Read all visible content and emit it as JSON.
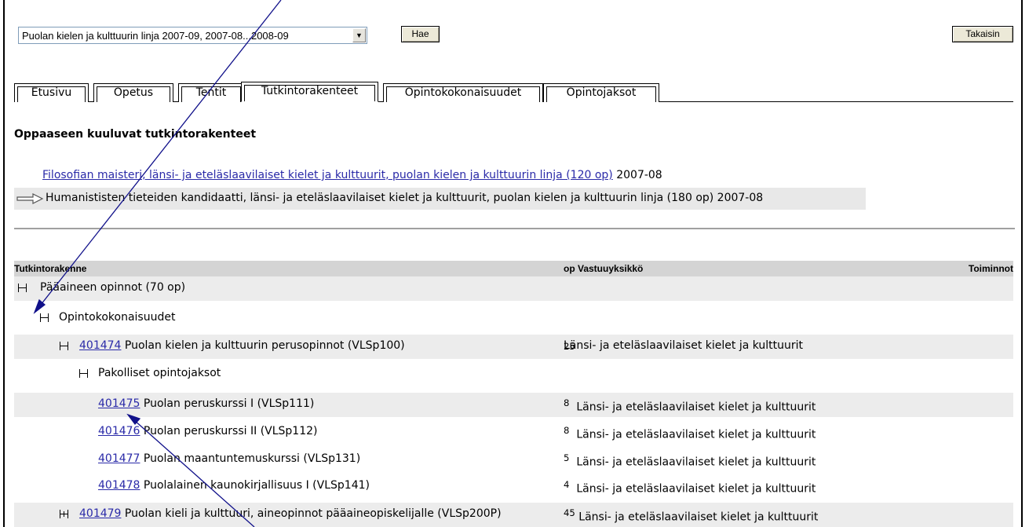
{
  "program_select": {
    "value": "Puolan kielen ja kulttuurin linja 2007-09, 2007-08...2008-09"
  },
  "buttons": {
    "hae": "Hae",
    "back": "Takaisin"
  },
  "tabs": [
    {
      "label": "Etusivu"
    },
    {
      "label": "Opetus"
    },
    {
      "label": "Tentit"
    },
    {
      "label": "Tutkintorakenteet"
    },
    {
      "label": "Opintokokonaisuudet"
    },
    {
      "label": "Opintojaksot"
    }
  ],
  "heading": "Oppaaseen kuuluvat tutkintorakenteet",
  "degrees": [
    {
      "link": "Filosofian maisteri, länsi- ja eteläslaavilaiset kielet ja kulttuurit, puolan kielen ja kulttuurin linja (120 op)",
      "year": "2007-08"
    },
    {
      "text": "Humanististen tieteiden kandidaatti, länsi- ja eteläslaavilaiset kielet ja kulttuurit, puolan kielen ja kulttuurin linja (180 op) 2007-08"
    }
  ],
  "table": {
    "headers": {
      "structure": "Tutkintorakenne",
      "op_unit": "op Vastuuyksikkö",
      "actions": "Toiminnot"
    },
    "rows": [
      {
        "code": "",
        "text": "Pääaineen opinnot (70 op)",
        "op": "",
        "unit": ""
      },
      {
        "code": "",
        "text": "Opintokokonaisuudet",
        "op": "",
        "unit": ""
      },
      {
        "code": "401474",
        "text": " Puolan kielen ja kulttuurin perusopinnot (VLSp100)",
        "op": "25",
        "unit": "Länsi- ja eteläslaavilaiset kielet ja kulttuurit"
      },
      {
        "code": "",
        "text": "Pakolliset opintojaksot",
        "op": "",
        "unit": ""
      },
      {
        "code": "401475",
        "text": " Puolan peruskurssi I (VLSp111)",
        "op": "8",
        "unit": "Länsi- ja eteläslaavilaiset kielet ja kulttuurit"
      },
      {
        "code": "401476",
        "text": " Puolan peruskurssi II (VLSp112)",
        "op": "8",
        "unit": "Länsi- ja eteläslaavilaiset kielet ja kulttuurit"
      },
      {
        "code": "401477",
        "text": " Puolan maantuntemuskurssi (VLSp131)",
        "op": "5",
        "unit": "Länsi- ja eteläslaavilaiset kielet ja kulttuurit"
      },
      {
        "code": "401478",
        "text": " Puolalainen kaunokirjallisuus I (VLSp141)",
        "op": "4",
        "unit": "Länsi- ja eteläslaavilaiset kielet ja kulttuurit"
      },
      {
        "code": "401479",
        "text": " Puolan kieli ja kulttuuri, aineopinnot pääaineopiskelijalle (VLSp200P)",
        "op": "45",
        "unit": "Länsi- ja eteläslaavilaiset kielet ja kulttuurit"
      }
    ]
  }
}
